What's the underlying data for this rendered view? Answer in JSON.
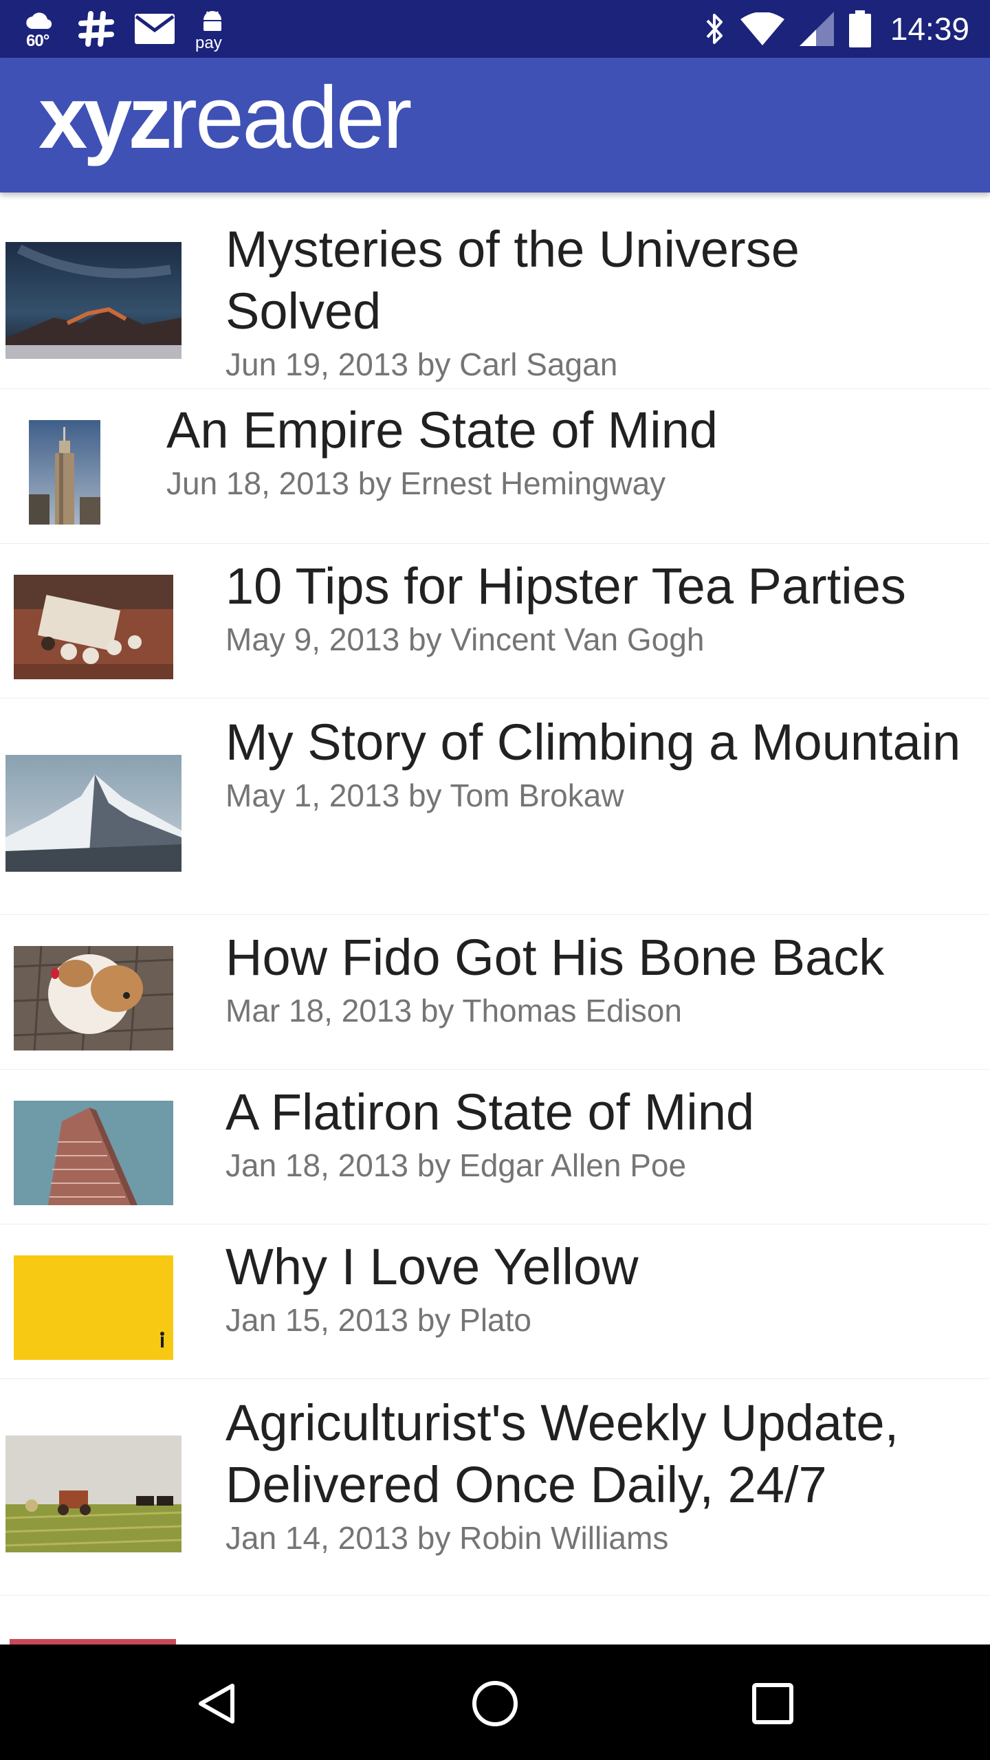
{
  "status_bar": {
    "temperature": "60°",
    "pay_label": "pay",
    "time": "14:39",
    "icons": [
      "weather-icon",
      "slack-icon",
      "mail-icon",
      "android-pay-icon",
      "bluetooth-icon",
      "wifi-icon",
      "signal-icon",
      "battery-icon"
    ]
  },
  "app_bar": {
    "logo_bold": "xyz",
    "logo_light": "reader",
    "color": "#3f51b5"
  },
  "articles": [
    {
      "title": "Mysteries of the Universe Solved",
      "meta": "Jun 19, 2013 by Carl Sagan",
      "image": "night-sky-mountains"
    },
    {
      "title": "An Empire State of Mind",
      "meta": "Jun 18, 2013 by Ernest Hemingway",
      "image": "empire-state-building"
    },
    {
      "title": "10 Tips for Hipster Tea Parties",
      "meta": "May 9, 2013 by Vincent Van Gogh",
      "image": "tea-cups-on-table"
    },
    {
      "title": "My Story of Climbing a Mountain",
      "meta": "May 1, 2013 by Tom Brokaw",
      "image": "snowy-mountain"
    },
    {
      "title": "How Fido Got His Bone Back",
      "meta": "Mar 18, 2013 by Thomas Edison",
      "image": "bulldog"
    },
    {
      "title": "A Flatiron State of Mind",
      "meta": "Jan 18, 2013 by Edgar Allen Poe",
      "image": "flatiron-building"
    },
    {
      "title": "Why I Love Yellow",
      "meta": "Jan 15, 2013 by Plato",
      "image": "yellow-wall"
    },
    {
      "title": "Agriculturist's Weekly Update, Delivered Once Daily, 24/7",
      "meta": "Jan 14, 2013 by Robin Williams",
      "image": "farm-field"
    }
  ],
  "nav_bar": {
    "buttons": [
      "back-icon",
      "home-icon",
      "recents-icon"
    ]
  }
}
